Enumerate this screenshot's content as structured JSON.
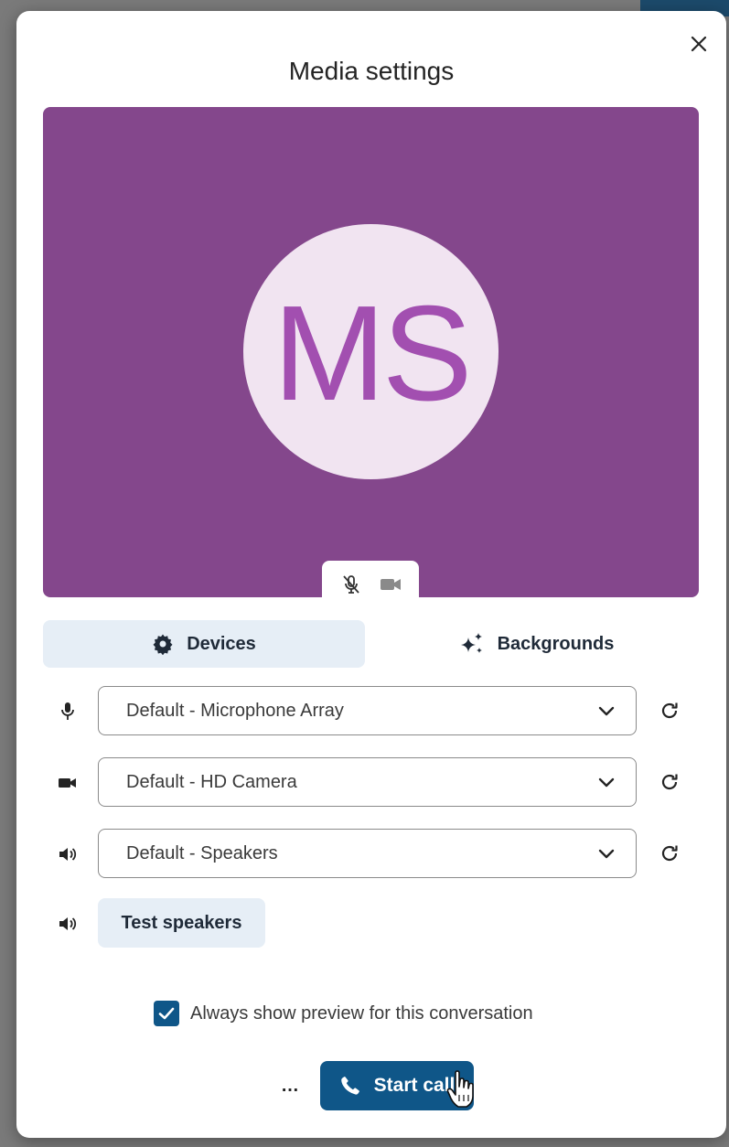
{
  "dialog": {
    "title": "Media settings",
    "close_icon": "close-icon"
  },
  "preview": {
    "background_color": "#84478c",
    "avatar_initials": "MS",
    "avatar_bg": "#f1e4f1",
    "avatar_fg": "#a24fb0",
    "mic_icon": "mic-off-icon",
    "camera_icon": "camera-off-icon"
  },
  "tabs": [
    {
      "label": "Devices",
      "icon": "gear-icon",
      "selected": true
    },
    {
      "label": "Backgrounds",
      "icon": "sparkle-icon",
      "selected": false
    }
  ],
  "devices": {
    "microphone": {
      "icon": "microphone-icon",
      "value": "Default - Microphone Array"
    },
    "camera": {
      "icon": "camera-icon",
      "value": "Default - HD Camera"
    },
    "speaker": {
      "icon": "speaker-icon",
      "value": "Default - Speakers"
    },
    "test_speakers_label": "Test speakers"
  },
  "options": {
    "always_show_preview_label": "Always show preview for this conversation",
    "always_show_preview_checked": true
  },
  "footer": {
    "more_label": "…",
    "start_call_label": "Start call"
  },
  "colors": {
    "accent": "#0f5688",
    "tab_selected_bg": "#e6eef6"
  }
}
